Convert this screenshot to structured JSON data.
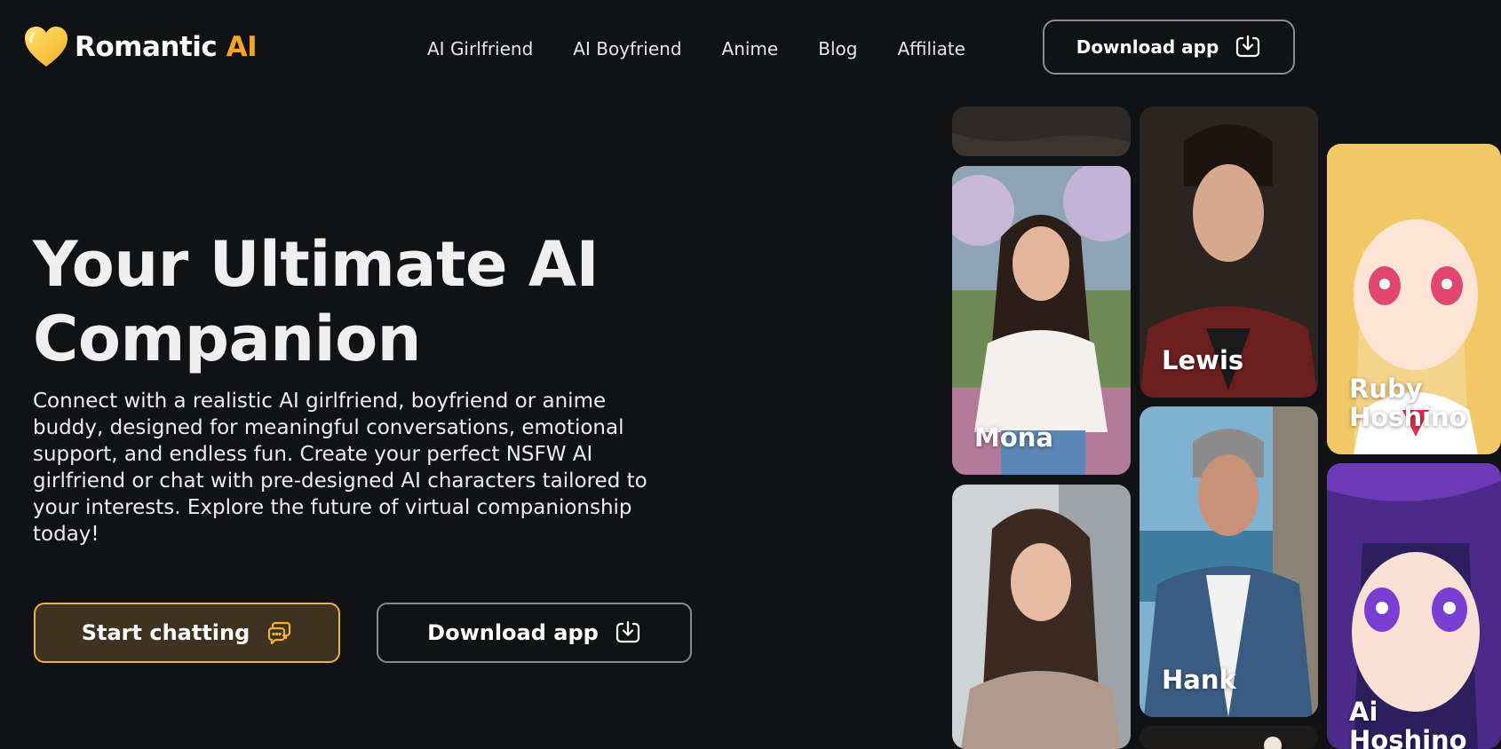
{
  "header": {
    "logo": {
      "text": "Romantic",
      "accent": "AI",
      "accent_color": "#f6a521",
      "icon": "heart-icon"
    },
    "nav": [
      {
        "label": "AI Girlfriend"
      },
      {
        "label": "AI Boyfriend"
      },
      {
        "label": "Anime"
      },
      {
        "label": "Blog"
      },
      {
        "label": "Affiliate"
      }
    ],
    "download_button": {
      "label": "Download app",
      "icon": "download-icon"
    }
  },
  "hero": {
    "title_line1": "Your Ultimate AI",
    "title_line2": "Companion",
    "description": "Connect with a realistic AI girlfriend, boyfriend or anime buddy, designed for meaningful conversations, emotional support, and endless fun. Create your perfect NSFW AI girlfriend or chat with pre-designed AI characters tailored to your interests. Explore the future of virtual companionship today!",
    "start_button": {
      "label": "Start chatting",
      "icon": "chat-bubbles-icon"
    },
    "download_button": {
      "label": "Download app",
      "icon": "download-icon"
    }
  },
  "characters": [
    {
      "name": ""
    },
    {
      "name": "Mona"
    },
    {
      "name": ""
    },
    {
      "name": "Lewis"
    },
    {
      "name": "Hank"
    },
    {
      "name": ""
    },
    {
      "name": "Ruby Hoshino"
    },
    {
      "name": "Ai Hoshino"
    }
  ],
  "colors": {
    "background": "#111214",
    "accent": "#f6a521",
    "start_button_bg": "#3f3220",
    "start_button_border": "#f3b23a"
  }
}
